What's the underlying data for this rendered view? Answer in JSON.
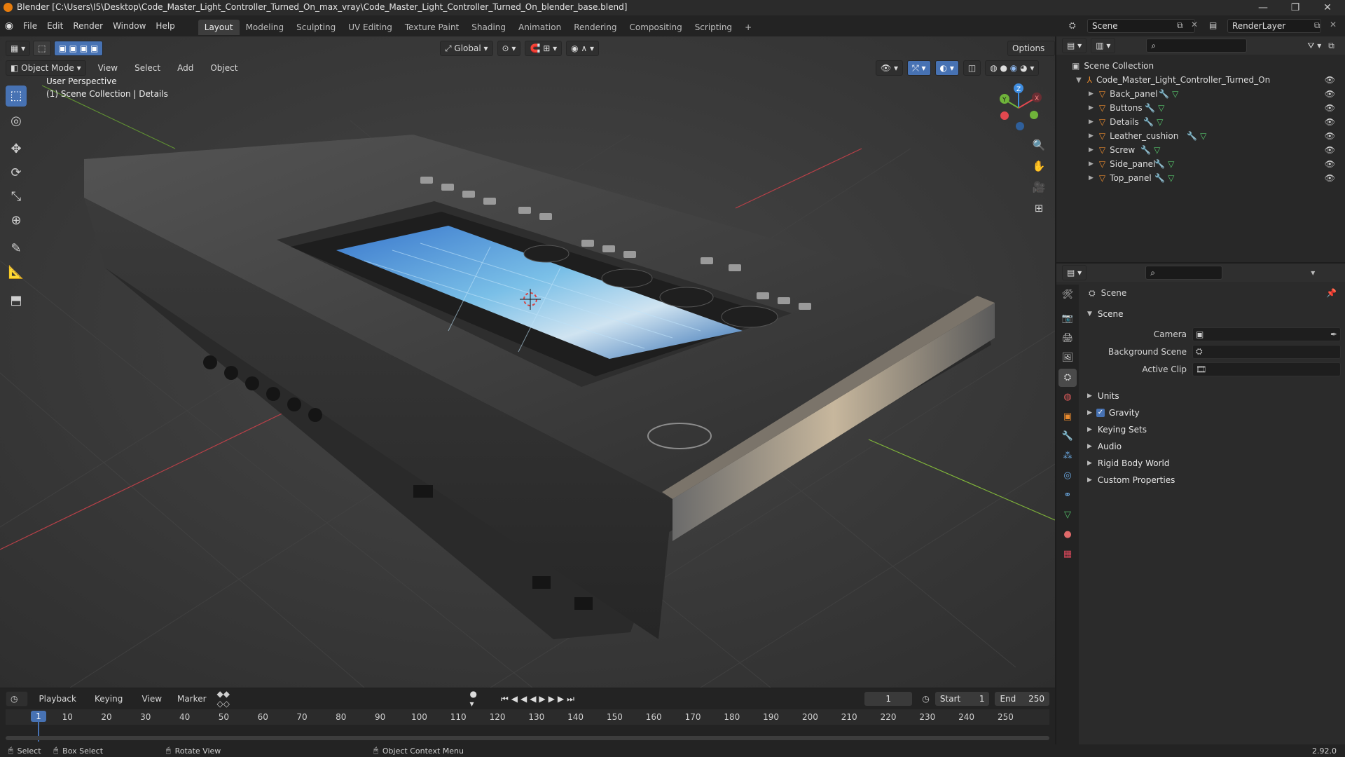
{
  "window": {
    "title": "Blender [C:\\Users\\I5\\Desktop\\Code_Master_Light_Controller_Turned_On_max_vray\\Code_Master_Light_Controller_Turned_On_blender_base.blend]",
    "controls": {
      "minimize": "—",
      "maximize": "❐",
      "close": "✕"
    }
  },
  "menu": [
    "File",
    "Edit",
    "Render",
    "Window",
    "Help"
  ],
  "workspaces": [
    "Layout",
    "Modeling",
    "Sculpting",
    "UV Editing",
    "Texture Paint",
    "Shading",
    "Animation",
    "Rendering",
    "Compositing",
    "Scripting"
  ],
  "active_workspace": "Layout",
  "add_tab_label": "+",
  "scene_field": "Scene",
  "render_layer_field": "RenderLayer",
  "viewport": {
    "mode": "Object Mode",
    "menus": [
      "View",
      "Select",
      "Add",
      "Object"
    ],
    "transform_orientation": "Global",
    "options_label": "Options",
    "overlay_line1": "User Perspective",
    "overlay_line2": "(1) Scene Collection | Details",
    "gizmo_axes": {
      "x": "X",
      "y": "Y",
      "z": "Z"
    }
  },
  "colors": {
    "accent": "#4772b3",
    "axis_x": "#e2484f",
    "axis_y": "#6fb33a",
    "axis_z": "#3f8de0",
    "mesh_icon": "#e88a2e",
    "modifier_icon": "#6aa7e0",
    "data_icon": "#55c26b"
  },
  "outliner": {
    "root": "Scene Collection",
    "collection": "Code_Master_Light_Controller_Turned_On",
    "objects": [
      "Back_panel",
      "Buttons",
      "Details",
      "Leather_cushion",
      "Screw",
      "Side_panel",
      "Top_panel"
    ]
  },
  "properties": {
    "context_label": "Scene",
    "panel_title": "Scene",
    "fields": [
      {
        "label": "Camera",
        "value": ""
      },
      {
        "label": "Background Scene",
        "value": ""
      },
      {
        "label": "Active Clip",
        "value": ""
      }
    ],
    "sections": [
      "Units",
      "Gravity",
      "Keying Sets",
      "Audio",
      "Rigid Body World",
      "Custom Properties"
    ],
    "gravity_checked": true
  },
  "timeline": {
    "menus": [
      "Playback",
      "Keying",
      "View",
      "Marker"
    ],
    "current_frame": "1",
    "start_label": "Start",
    "start": "1",
    "end_label": "End",
    "end": "250",
    "playhead": "1",
    "ticks": [
      "10",
      "20",
      "30",
      "40",
      "50",
      "60",
      "70",
      "80",
      "90",
      "100",
      "110",
      "120",
      "130",
      "140",
      "150",
      "160",
      "170",
      "180",
      "190",
      "200",
      "210",
      "220",
      "230",
      "240",
      "250"
    ]
  },
  "status": {
    "items": [
      "Select",
      "Box Select",
      "Rotate View",
      "Object Context Menu"
    ],
    "version": "2.92.0"
  }
}
